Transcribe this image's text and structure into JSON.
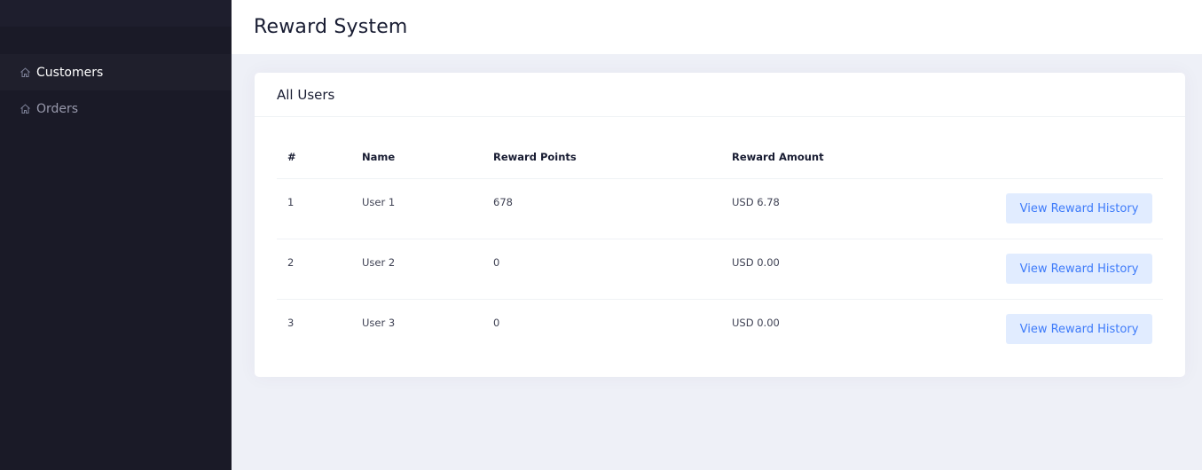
{
  "sidebar": {
    "items": [
      {
        "label": "Customers",
        "icon": "home-icon",
        "active": true
      },
      {
        "label": "Orders",
        "icon": "home-icon",
        "active": false
      }
    ]
  },
  "header": {
    "title": "Reward System"
  },
  "card": {
    "title": "All Users",
    "columns": [
      "#",
      "Name",
      "Reward Points",
      "Reward Amount"
    ],
    "rows": [
      {
        "index": "1",
        "name": "User 1",
        "points": "678",
        "amount": "USD 6.78",
        "action": "View Reward History"
      },
      {
        "index": "2",
        "name": "User 2",
        "points": "0",
        "amount": "USD 0.00",
        "action": "View Reward History"
      },
      {
        "index": "3",
        "name": "User 3",
        "points": "0",
        "amount": "USD 0.00",
        "action": "View Reward History"
      }
    ]
  },
  "colors": {
    "sidebar_bg": "#1a1a27",
    "accent": "#3e7bfa",
    "button_bg": "#e1ecff",
    "page_bg": "#eef0f7"
  }
}
